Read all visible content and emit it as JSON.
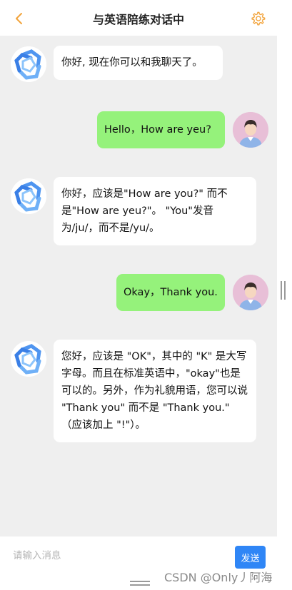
{
  "header": {
    "title": "与英语陪练对话中",
    "back_icon": "chevron-left-icon",
    "settings_icon": "gear-icon",
    "accent_color": "#f2a33a"
  },
  "messages": [
    {
      "sender": "bot",
      "text": "你好, 现在你可以和我聊天了。"
    },
    {
      "sender": "user",
      "text": "Hello，How are yeu?"
    },
    {
      "sender": "bot",
      "text": "你好，应该是\"How are you?\" 而不是\"How are yeu?\"。 \"You\"发音为/ju/，而不是/yu/。"
    },
    {
      "sender": "user",
      "text": "Okay，Thank you."
    },
    {
      "sender": "bot",
      "text": "您好，应该是 \"OK\"，其中的 \"K\" 是大写字母。而且在标准英语中，\"okay\"也是可以的。另外，作为礼貌用语，您可以说 \"Thank you\" 而不是 \"Thank you.\" （应该加上 \"!\"）。"
    }
  ],
  "footer": {
    "input_placeholder": "请输入消息",
    "input_value": "",
    "send_label": "发送"
  },
  "colors": {
    "chat_background": "#efefef",
    "user_bubble": "#95f27b",
    "bot_bubble": "#ffffff",
    "send_button": "#2f86f6",
    "user_avatar_bg": "#e8bfd7"
  },
  "watermark": "CSDN @Only丿阿海"
}
